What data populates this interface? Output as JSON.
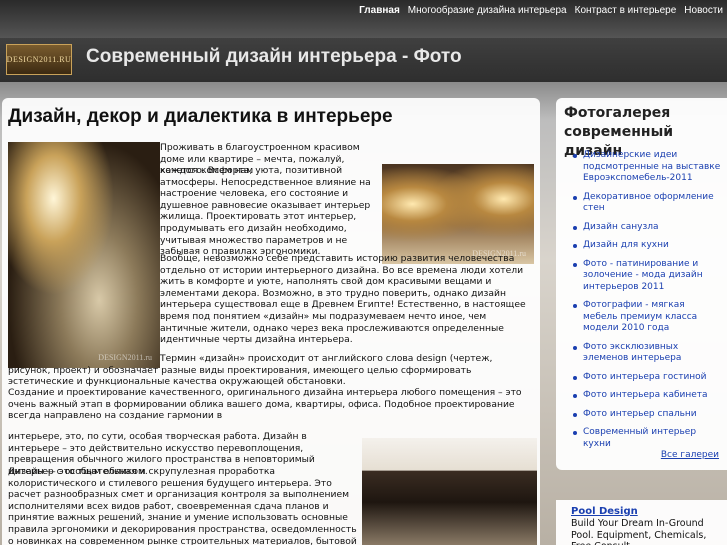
{
  "nav": {
    "items": [
      "Главная",
      "Многообразие дизайна интерьера",
      "Контраст в интерьере",
      "Новости"
    ]
  },
  "header": {
    "logo_text": "DESIGN2011.RU",
    "title": "Современный дизайн интерьера - Фото"
  },
  "main": {
    "title": "Дизайн, декор и диалектика в интерьере",
    "watermark": "DESIGN2011.ru",
    "paragraphs": [
      "Проживать в благоустроенном красивом доме или квартире – мечта, пожалуй, каждого. Всем нам",
      "хочется комфорта, уюта, позитивной атмосферы. Непосредственное влияние на настроение человека, его состояние и душевное равновесие оказывает интерьер жилища. Проектировать этот интерьер, продумывать его дизайн необходимо, учитывая множество параметров и не забывая о правилах эргономики.",
      "Вообще, невозможно себе представить историю развития человечества отдельно от истории интерьерного дизайна. Во все времена люди хотели жить в комфорте и уюте, наполнять свой дом красивыми вещами и элементами декора. Возможно, в это трудно поверить, однако дизайн интерьера существовал еще в Древнем Египте! Естественно, в настоящее время под понятием «дизайн» мы подразумеваем нечто иное, чем античные жители, однако через века прослеживаются определенные идентичные черты дизайна интерьера.",
      "Термин «дизайн» происходит от английского слова design (чертеж, рисунок, проект) и обозначает разные виды проектирования, имеющего целью сформировать эстетические и функциональные качества окружающей обстановки.",
      "Создание и проектирование качественного, оригинального дизайна интерьера любого помещения – это очень важный этап в формировании облика вашего дома, квартиры, офиса. Подобное проектирование всегда направлено на создание гармонии в",
      "интерьере, это, по сути, особая творческая работа. Дизайн в интерьере – это действительно искусство перевоплощения, превращения обычного жилого пространства в неповторимый интерьер с особым обликом.",
      "Дизайн — это тщательная и скрупулезная проработка колористического и стилевого решения будущего интерьера. Это расчет разнообразных смет и организация контроля за выполнением исполнителями всех видов работ, своевременная сдача планов и принятие важных решений, знание и умение использовать основные правила эргономики и декорирования пространства, осведомленность о новинках на современном рынке строительных материалов, бытовой техники и новейших технологий."
    ]
  },
  "sidebar": {
    "title": "Фотогалерея современный дизайн",
    "links": [
      "Дизайнерские идеи подсмотренные на выставке Евроэкспомебель-2011",
      "Декоративное оформление стен",
      "Дизайн санузла",
      "Дизайн для кухни",
      "Фото - патинирование и золочение - мода дизайн интерьеров 2011",
      "Фотографии - мягкая мебель премиум класса модели 2010 года",
      "Фото эксклюзивных элеменов интерьера",
      "Фото интерьера гостиной",
      "Фото интерьера кабинета",
      "Фото интерьер спальни",
      "Современный интерьер кухни"
    ],
    "all_link": "Все галереи"
  },
  "ad": {
    "title": "Pool Design",
    "text": "Build Your Dream In-Ground Pool. Equipment, Chemicals, Free Consult"
  }
}
